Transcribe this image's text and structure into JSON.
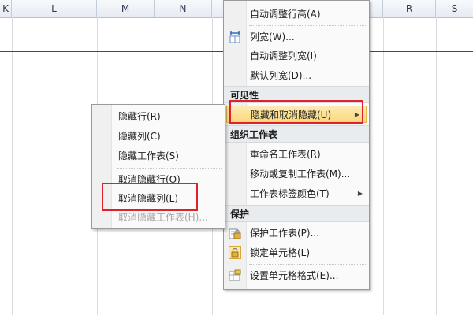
{
  "sheet": {
    "columns": [
      "K",
      "L",
      "M",
      "N",
      "R",
      "S"
    ]
  },
  "main_menu": {
    "items_top": [
      "自动调整行高(A)",
      "列宽(W)...",
      "自动调整列宽(I)",
      "默认列宽(D)..."
    ],
    "visibility_header": "可见性",
    "hide_unhide": "隐藏和取消隐藏(U)",
    "organize_header": "组织工作表",
    "organize_items": [
      "重命名工作表(R)",
      "移动或复制工作表(M)...",
      "工作表标签颜色(T)"
    ],
    "protect_header": "保护",
    "protect_items": [
      "保护工作表(P)...",
      "锁定单元格(L)",
      "设置单元格格式(E)..."
    ]
  },
  "submenu": {
    "items": [
      "隐藏行(R)",
      "隐藏列(C)",
      "隐藏工作表(S)",
      "取消隐藏行(O)",
      "取消隐藏列(L)",
      "取消隐藏工作表(H)..."
    ]
  },
  "colors": {
    "highlight_border": "#e0202a",
    "hover_fill": "#fbd978"
  }
}
